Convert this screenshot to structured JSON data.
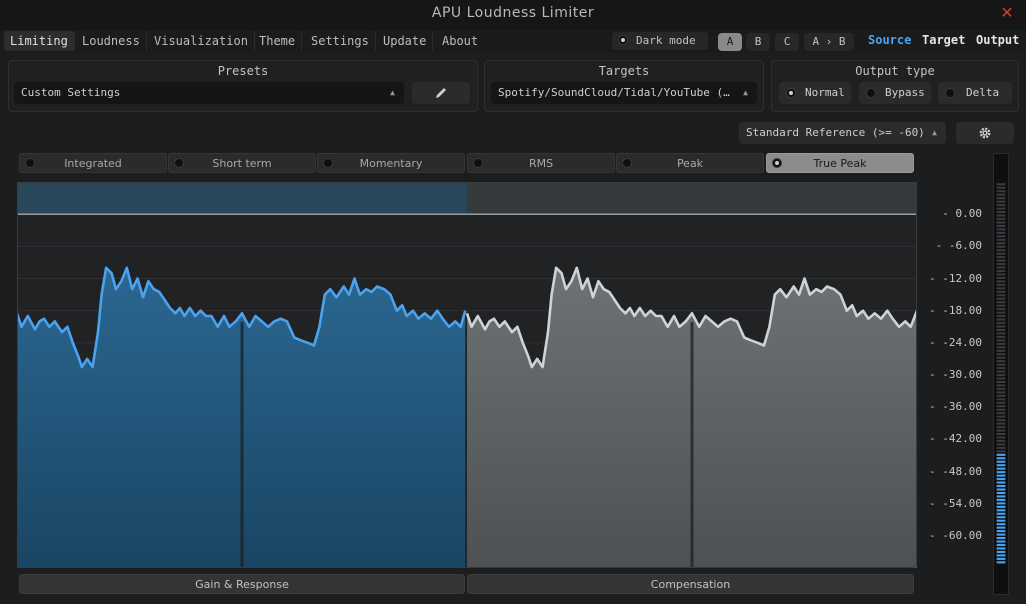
{
  "app": {
    "title": "APU Loudness Limiter",
    "close": "✕"
  },
  "menu": [
    "Limiting",
    "Loudness",
    "Visualization",
    "Theme",
    "Settings",
    "Update",
    "About"
  ],
  "dark_mode": {
    "label": "Dark mode",
    "checked": true
  },
  "abc": {
    "a": "A",
    "b": "B",
    "c": "C",
    "ab": "A › B",
    "selected": "A"
  },
  "view": {
    "source": "Source",
    "target": "Target",
    "output": "Output",
    "source_color": "#4aa3f0",
    "target_color": "#e6e6e6",
    "output_color": "#e6e6e6"
  },
  "presets": {
    "title": "Presets",
    "value": "Custom Settings",
    "edit_icon": "pencil-icon"
  },
  "targets": {
    "title": "Targets",
    "value": "Spotify/SoundCloud/Tidal/YouTube (…"
  },
  "output_type": {
    "title": "Output type",
    "normal": "Normal",
    "bypass": "Bypass",
    "delta": "Delta",
    "selected": "Normal"
  },
  "reference": {
    "value": "Standard Reference (>= -60)",
    "settings_icon": "gear-icon"
  },
  "meter_tabs": [
    "Integrated",
    "Short term",
    "Momentary",
    "RMS",
    "Peak",
    "True Peak"
  ],
  "selected_meter_tab": "True Peak",
  "bottom": {
    "left": "Gain & Response",
    "right": "Compensation"
  },
  "colors": {
    "source": "#4aa3f0",
    "output": "#cfd3d6",
    "accent": "#4aa3f0",
    "close": "#d23c32"
  },
  "chart_data": {
    "type": "line",
    "y_tick_labels": [
      "0.00",
      "-6.00",
      "-12.00",
      "-18.00",
      "-24.00",
      "-30.00",
      "-36.00",
      "-42.00",
      "-48.00",
      "-54.00",
      "-60.00"
    ],
    "ylim": [
      -66,
      6
    ],
    "x_range": [
      0,
      100
    ],
    "series": [
      {
        "values": [
          [
            0,
            -18.5
          ],
          [
            0.5,
            -21
          ],
          [
            1.2,
            -19
          ],
          [
            2,
            -21.5
          ],
          [
            2.5,
            -20
          ],
          [
            3,
            -19.5
          ],
          [
            3.6,
            -21
          ],
          [
            4.2,
            -20
          ],
          [
            5,
            -22
          ],
          [
            5.6,
            -21
          ],
          [
            6.2,
            -24
          ],
          [
            6.8,
            -26.5
          ],
          [
            7.2,
            -28.5
          ],
          [
            7.8,
            -27
          ],
          [
            8.4,
            -28.5
          ],
          [
            9,
            -22
          ],
          [
            9.4,
            -15
          ],
          [
            9.9,
            -10
          ],
          [
            10.5,
            -11
          ],
          [
            11,
            -14
          ],
          [
            11.6,
            -12.5
          ],
          [
            12.2,
            -10
          ],
          [
            12.8,
            -14
          ],
          [
            13.4,
            -12
          ],
          [
            14,
            -15.5
          ],
          [
            14.6,
            -12.5
          ],
          [
            15.2,
            -14
          ],
          [
            15.8,
            -14.5
          ],
          [
            16.4,
            -16
          ],
          [
            17,
            -17.5
          ],
          [
            17.6,
            -18.5
          ],
          [
            18.1,
            -17.5
          ],
          [
            18.6,
            -19
          ],
          [
            19.2,
            -17.5
          ],
          [
            19.8,
            -19
          ],
          [
            20.4,
            -18
          ],
          [
            21,
            -19
          ],
          [
            21.6,
            -19
          ],
          [
            22.3,
            -21
          ],
          [
            23,
            -19
          ],
          [
            23.6,
            -21
          ],
          [
            24.3,
            -20
          ],
          [
            25,
            -18.5
          ],
          [
            25.8,
            -21
          ],
          [
            26.5,
            -19
          ],
          [
            27.2,
            -20
          ],
          [
            27.9,
            -21
          ],
          [
            28.6,
            -20
          ],
          [
            29.3,
            -19.5
          ],
          [
            30,
            -20
          ],
          [
            30.8,
            -23
          ],
          [
            31.5,
            -23.5
          ],
          [
            32.3,
            -24
          ],
          [
            33,
            -24.5
          ],
          [
            33.6,
            -21
          ],
          [
            34.2,
            -15
          ],
          [
            34.8,
            -14
          ],
          [
            35.5,
            -15.5
          ],
          [
            36.3,
            -13.5
          ],
          [
            36.9,
            -15
          ],
          [
            37.5,
            -12
          ],
          [
            38.1,
            -15
          ],
          [
            38.8,
            -14
          ],
          [
            39.4,
            -14.5
          ],
          [
            40,
            -13.5
          ],
          [
            40.8,
            -14
          ],
          [
            41.5,
            -15
          ],
          [
            42.2,
            -18
          ],
          [
            42.8,
            -17
          ],
          [
            43.3,
            -19
          ],
          [
            44,
            -18
          ],
          [
            44.6,
            -19.5
          ],
          [
            45.3,
            -18.5
          ],
          [
            46,
            -19.5
          ],
          [
            46.7,
            -18
          ],
          [
            47.3,
            -19.5
          ],
          [
            48,
            -21
          ],
          [
            48.7,
            -20
          ],
          [
            49.3,
            -21
          ],
          [
            49.8,
            -18
          ]
        ]
      },
      {
        "values": [
          [
            50,
            -18.5
          ],
          [
            50.5,
            -21
          ],
          [
            51.2,
            -19
          ],
          [
            52,
            -21.5
          ],
          [
            52.5,
            -20
          ],
          [
            53,
            -19.5
          ],
          [
            53.6,
            -21
          ],
          [
            54.2,
            -20
          ],
          [
            55,
            -22
          ],
          [
            55.6,
            -21
          ],
          [
            56.2,
            -24
          ],
          [
            56.8,
            -26.5
          ],
          [
            57.2,
            -28.5
          ],
          [
            57.8,
            -27
          ],
          [
            58.4,
            -28.5
          ],
          [
            59,
            -22
          ],
          [
            59.4,
            -15
          ],
          [
            59.9,
            -10
          ],
          [
            60.5,
            -11
          ],
          [
            61,
            -14
          ],
          [
            61.6,
            -12.5
          ],
          [
            62.2,
            -10
          ],
          [
            62.8,
            -14
          ],
          [
            63.4,
            -12
          ],
          [
            64,
            -15.5
          ],
          [
            64.6,
            -12.5
          ],
          [
            65.2,
            -14
          ],
          [
            65.8,
            -14.5
          ],
          [
            66.4,
            -16
          ],
          [
            67,
            -17.5
          ],
          [
            67.6,
            -18.5
          ],
          [
            68.1,
            -17.5
          ],
          [
            68.6,
            -19
          ],
          [
            69.2,
            -17.5
          ],
          [
            69.8,
            -19
          ],
          [
            70.4,
            -18
          ],
          [
            71,
            -19
          ],
          [
            71.6,
            -19
          ],
          [
            72.3,
            -21
          ],
          [
            73,
            -19
          ],
          [
            73.6,
            -21
          ],
          [
            74.3,
            -20
          ],
          [
            75,
            -18.5
          ],
          [
            75.8,
            -21
          ],
          [
            76.5,
            -19
          ],
          [
            77.2,
            -20
          ],
          [
            77.9,
            -21
          ],
          [
            78.6,
            -20
          ],
          [
            79.3,
            -19.5
          ],
          [
            80,
            -20
          ],
          [
            80.8,
            -23
          ],
          [
            81.5,
            -23.5
          ],
          [
            82.3,
            -24
          ],
          [
            83,
            -24.5
          ],
          [
            83.6,
            -21
          ],
          [
            84.2,
            -15
          ],
          [
            84.8,
            -14
          ],
          [
            85.5,
            -15.5
          ],
          [
            86.3,
            -13.5
          ],
          [
            86.9,
            -15
          ],
          [
            87.5,
            -12
          ],
          [
            88.1,
            -15
          ],
          [
            88.8,
            -14
          ],
          [
            89.4,
            -14.5
          ],
          [
            90,
            -13.5
          ],
          [
            90.8,
            -14
          ],
          [
            91.5,
            -15
          ],
          [
            92.2,
            -18
          ],
          [
            92.8,
            -17
          ],
          [
            93.3,
            -19
          ],
          [
            94,
            -18
          ],
          [
            94.6,
            -19.5
          ],
          [
            95.3,
            -18.5
          ],
          [
            96,
            -19.5
          ],
          [
            96.7,
            -18
          ],
          [
            97.3,
            -19.5
          ],
          [
            98,
            -21
          ],
          [
            98.7,
            -20
          ],
          [
            99.3,
            -21
          ],
          [
            100,
            -18
          ]
        ]
      }
    ],
    "target_line": 0,
    "meter_level_db": -45,
    "grid": true
  }
}
